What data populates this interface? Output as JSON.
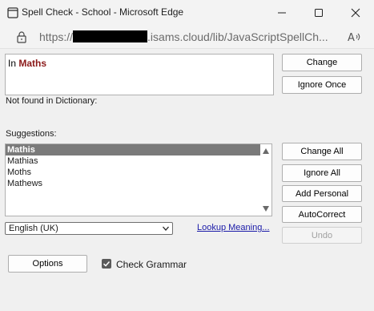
{
  "window": {
    "title": "Spell Check - School - Microsoft Edge",
    "url_prefix": "https://",
    "url_suffix": ".isams.cloud/lib/JavaScriptSpellCh..."
  },
  "word_box": {
    "context_prefix": "In ",
    "misspelled_word": "Maths"
  },
  "status_text": "Not found in Dictionary:",
  "suggestions_label": "Suggestions:",
  "suggestions": [
    "Mathis",
    "Mathias",
    "Moths",
    "Mathews"
  ],
  "selected_suggestion_index": 0,
  "buttons": {
    "change": "Change",
    "ignore_once": "Ignore Once",
    "change_all": "Change All",
    "ignore_all": "Ignore All",
    "add_personal": "Add Personal",
    "autocorrect": "AutoCorrect",
    "undo": "Undo",
    "options": "Options"
  },
  "language": {
    "selected": "English (UK)"
  },
  "lookup_link": "Lookup Meaning...",
  "check_grammar": {
    "label": "Check Grammar",
    "checked": true
  },
  "icons": {
    "app": "spell-check-app-icon",
    "lock": "lock-icon",
    "reader": "read-aloud-icon"
  }
}
